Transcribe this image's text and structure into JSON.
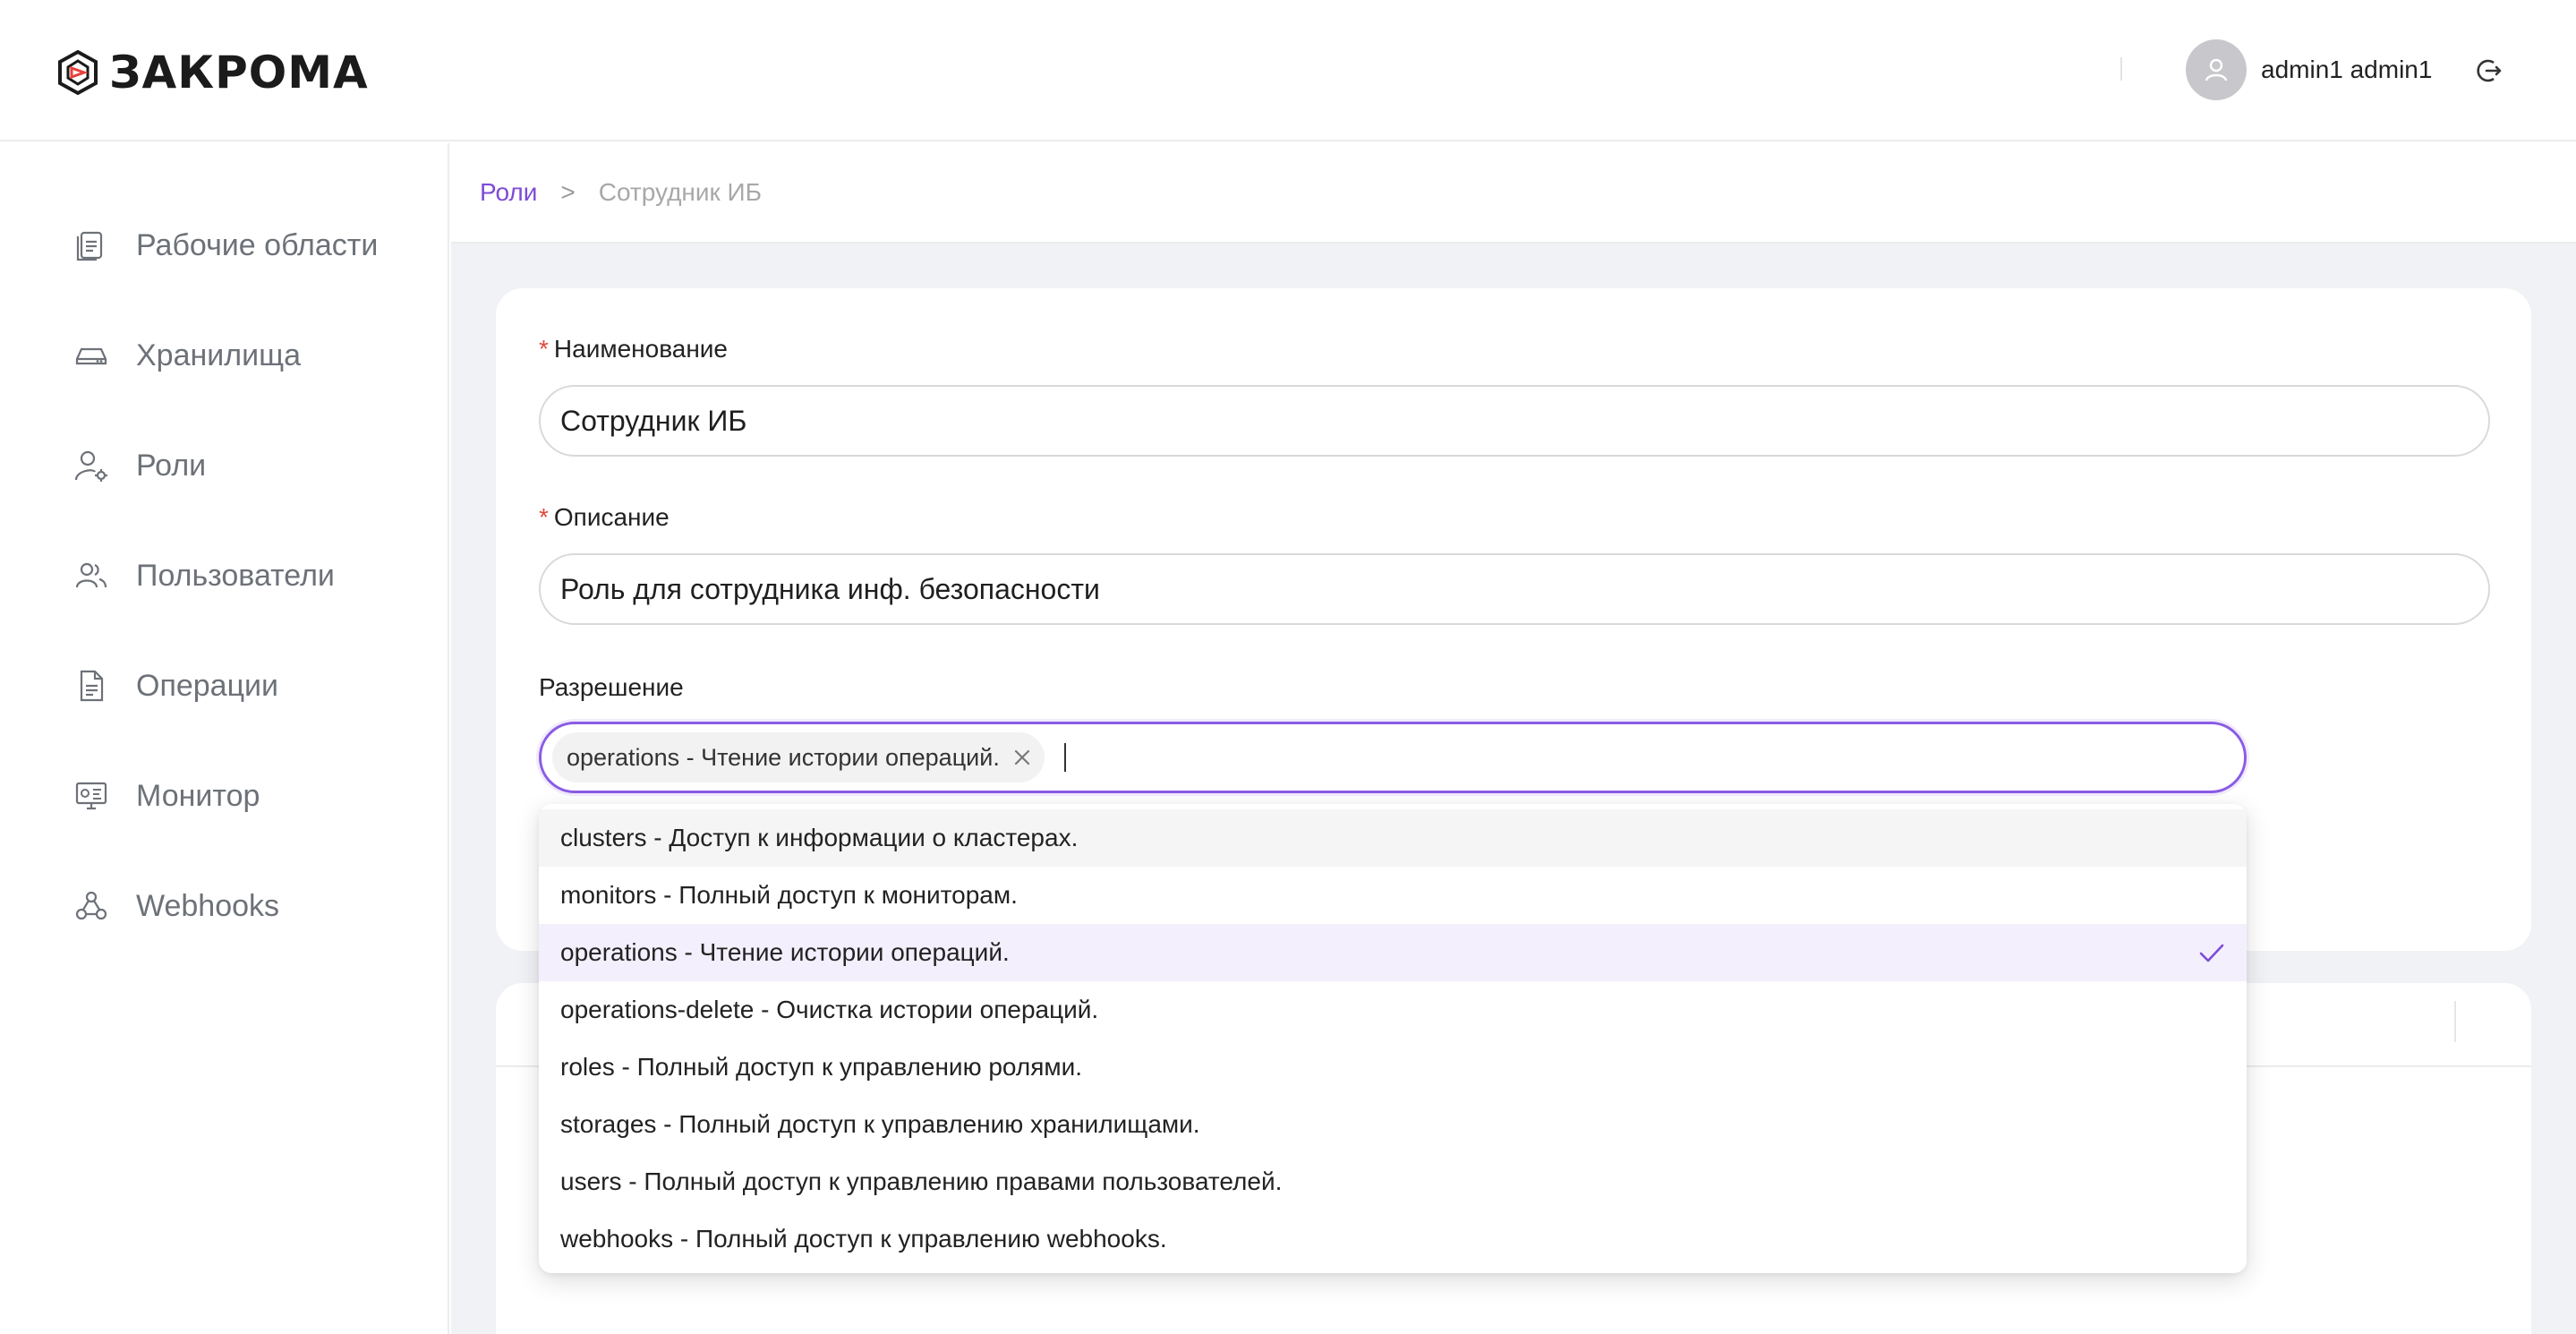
{
  "brand": {
    "name": "ЗАКРОМА"
  },
  "user": {
    "name": "admin1 admin1"
  },
  "sidebar": {
    "items": [
      {
        "label": "Рабочие области",
        "icon": "workspaces-icon"
      },
      {
        "label": "Хранилища",
        "icon": "storage-icon"
      },
      {
        "label": "Роли",
        "icon": "roles-icon"
      },
      {
        "label": "Пользователи",
        "icon": "users-icon"
      },
      {
        "label": "Операции",
        "icon": "operations-icon"
      },
      {
        "label": "Монитор",
        "icon": "monitor-icon"
      },
      {
        "label": "Webhooks",
        "icon": "webhooks-icon"
      }
    ]
  },
  "breadcrumb": {
    "parent": "Роли",
    "separator": ">",
    "current": "Сотрудник ИБ"
  },
  "form": {
    "name_label": "Наименование",
    "name_value": "Сотрудник ИБ",
    "description_label": "Описание",
    "description_value": "Роль для сотрудника инф. безопасности",
    "permission_label": "Разрешение",
    "required_mark": "*",
    "selected_tags": [
      "operations - Чтение истории операций."
    ]
  },
  "dropdown": {
    "options": [
      {
        "label": "clusters - Доступ к информации о кластерах.",
        "state": "hover"
      },
      {
        "label": "monitors - Полный доступ к мониторам.",
        "state": ""
      },
      {
        "label": "operations - Чтение истории операций.",
        "state": "selected"
      },
      {
        "label": "operations-delete - Очистка истории операций.",
        "state": ""
      },
      {
        "label": "roles - Полный доступ к управлению ролями.",
        "state": ""
      },
      {
        "label": "storages - Полный доступ к управлению хранилищами.",
        "state": ""
      },
      {
        "label": "users - Полный доступ к управлению правами пользователей.",
        "state": ""
      },
      {
        "label": "webhooks - Полный доступ к управлению webhooks.",
        "state": ""
      }
    ]
  },
  "colors": {
    "accent": "#7e4bd6",
    "required": "#e2483d",
    "selected_bg": "#f3effc"
  }
}
